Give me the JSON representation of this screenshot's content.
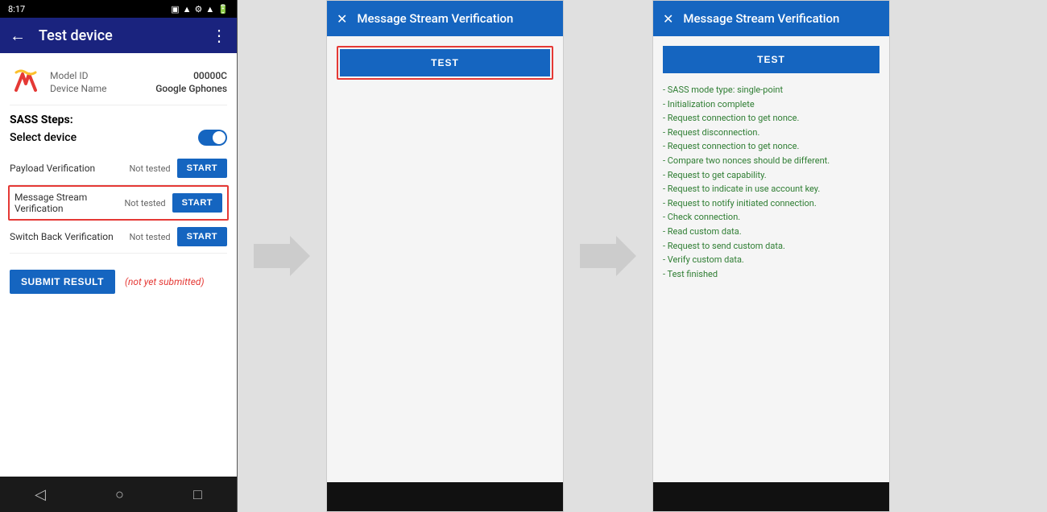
{
  "phone": {
    "status_bar": {
      "time": "8:17",
      "icons": [
        "notification",
        "signal",
        "wifi",
        "battery"
      ]
    },
    "toolbar": {
      "title": "Test device",
      "back_icon": "←",
      "more_icon": "⋮"
    },
    "device": {
      "model_label": "Model ID",
      "model_value": "00000C",
      "name_label": "Device Name",
      "name_value": "Google Gphones"
    },
    "sass_steps_title": "SASS Steps:",
    "select_device_label": "Select device",
    "steps": [
      {
        "label": "Payload Verification",
        "status": "Not tested",
        "btn": "START",
        "highlighted": false
      },
      {
        "label": "Message Stream\nVerification",
        "status": "Not tested",
        "btn": "START",
        "highlighted": true
      },
      {
        "label": "Switch Back Verification",
        "status": "Not tested",
        "btn": "START",
        "highlighted": false
      }
    ],
    "submit_btn": "SUBMIT RESULT",
    "submit_note": "(not yet submitted)",
    "nav": {
      "back": "◁",
      "home": "○",
      "recents": "□"
    }
  },
  "dialog1": {
    "toolbar": {
      "close_icon": "✕",
      "title": "Message Stream Verification"
    },
    "test_btn": "TEST"
  },
  "dialog2": {
    "toolbar": {
      "close_icon": "✕",
      "title": "Message Stream Verification"
    },
    "test_btn": "TEST",
    "results": [
      {
        "text": "- SASS mode type: single-point",
        "color": "green"
      },
      {
        "text": "- Initialization complete",
        "color": "green"
      },
      {
        "text": "- Request connection to get nonce.",
        "color": "green"
      },
      {
        "text": "- Request disconnection.",
        "color": "green"
      },
      {
        "text": "- Request connection to get nonce.",
        "color": "green"
      },
      {
        "text": "- Compare two nonces should be different.",
        "color": "green"
      },
      {
        "text": "- Request to get capability.",
        "color": "green"
      },
      {
        "text": "- Request to indicate in use account key.",
        "color": "green"
      },
      {
        "text": "- Request to notify initiated connection.",
        "color": "green"
      },
      {
        "text": "- Check connection.",
        "color": "green"
      },
      {
        "text": "- Read custom data.",
        "color": "green"
      },
      {
        "text": "- Request to send custom data.",
        "color": "green"
      },
      {
        "text": "- Verify custom data.",
        "color": "green"
      },
      {
        "text": "- Test finished",
        "color": "green"
      }
    ]
  }
}
